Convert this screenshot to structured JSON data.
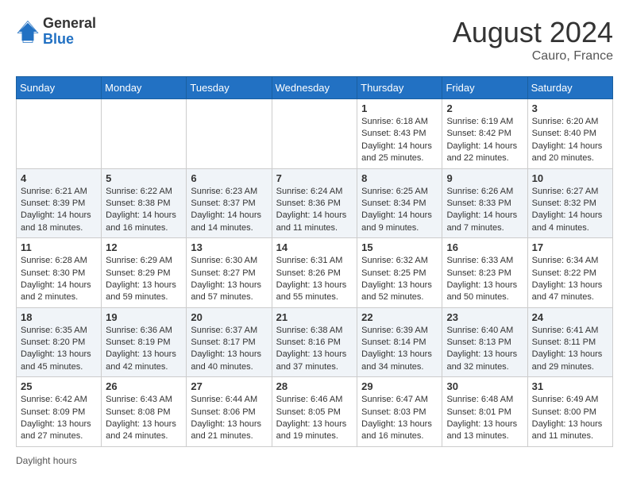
{
  "header": {
    "logo_general": "General",
    "logo_blue": "Blue",
    "month_year": "August 2024",
    "location": "Cauro, France"
  },
  "weekdays": [
    "Sunday",
    "Monday",
    "Tuesday",
    "Wednesday",
    "Thursday",
    "Friday",
    "Saturday"
  ],
  "weeks": [
    [
      {
        "day": "",
        "info": ""
      },
      {
        "day": "",
        "info": ""
      },
      {
        "day": "",
        "info": ""
      },
      {
        "day": "",
        "info": ""
      },
      {
        "day": "1",
        "info": "Sunrise: 6:18 AM\nSunset: 8:43 PM\nDaylight: 14 hours and 25 minutes."
      },
      {
        "day": "2",
        "info": "Sunrise: 6:19 AM\nSunset: 8:42 PM\nDaylight: 14 hours and 22 minutes."
      },
      {
        "day": "3",
        "info": "Sunrise: 6:20 AM\nSunset: 8:40 PM\nDaylight: 14 hours and 20 minutes."
      }
    ],
    [
      {
        "day": "4",
        "info": "Sunrise: 6:21 AM\nSunset: 8:39 PM\nDaylight: 14 hours and 18 minutes."
      },
      {
        "day": "5",
        "info": "Sunrise: 6:22 AM\nSunset: 8:38 PM\nDaylight: 14 hours and 16 minutes."
      },
      {
        "day": "6",
        "info": "Sunrise: 6:23 AM\nSunset: 8:37 PM\nDaylight: 14 hours and 14 minutes."
      },
      {
        "day": "7",
        "info": "Sunrise: 6:24 AM\nSunset: 8:36 PM\nDaylight: 14 hours and 11 minutes."
      },
      {
        "day": "8",
        "info": "Sunrise: 6:25 AM\nSunset: 8:34 PM\nDaylight: 14 hours and 9 minutes."
      },
      {
        "day": "9",
        "info": "Sunrise: 6:26 AM\nSunset: 8:33 PM\nDaylight: 14 hours and 7 minutes."
      },
      {
        "day": "10",
        "info": "Sunrise: 6:27 AM\nSunset: 8:32 PM\nDaylight: 14 hours and 4 minutes."
      }
    ],
    [
      {
        "day": "11",
        "info": "Sunrise: 6:28 AM\nSunset: 8:30 PM\nDaylight: 14 hours and 2 minutes."
      },
      {
        "day": "12",
        "info": "Sunrise: 6:29 AM\nSunset: 8:29 PM\nDaylight: 13 hours and 59 minutes."
      },
      {
        "day": "13",
        "info": "Sunrise: 6:30 AM\nSunset: 8:27 PM\nDaylight: 13 hours and 57 minutes."
      },
      {
        "day": "14",
        "info": "Sunrise: 6:31 AM\nSunset: 8:26 PM\nDaylight: 13 hours and 55 minutes."
      },
      {
        "day": "15",
        "info": "Sunrise: 6:32 AM\nSunset: 8:25 PM\nDaylight: 13 hours and 52 minutes."
      },
      {
        "day": "16",
        "info": "Sunrise: 6:33 AM\nSunset: 8:23 PM\nDaylight: 13 hours and 50 minutes."
      },
      {
        "day": "17",
        "info": "Sunrise: 6:34 AM\nSunset: 8:22 PM\nDaylight: 13 hours and 47 minutes."
      }
    ],
    [
      {
        "day": "18",
        "info": "Sunrise: 6:35 AM\nSunset: 8:20 PM\nDaylight: 13 hours and 45 minutes."
      },
      {
        "day": "19",
        "info": "Sunrise: 6:36 AM\nSunset: 8:19 PM\nDaylight: 13 hours and 42 minutes."
      },
      {
        "day": "20",
        "info": "Sunrise: 6:37 AM\nSunset: 8:17 PM\nDaylight: 13 hours and 40 minutes."
      },
      {
        "day": "21",
        "info": "Sunrise: 6:38 AM\nSunset: 8:16 PM\nDaylight: 13 hours and 37 minutes."
      },
      {
        "day": "22",
        "info": "Sunrise: 6:39 AM\nSunset: 8:14 PM\nDaylight: 13 hours and 34 minutes."
      },
      {
        "day": "23",
        "info": "Sunrise: 6:40 AM\nSunset: 8:13 PM\nDaylight: 13 hours and 32 minutes."
      },
      {
        "day": "24",
        "info": "Sunrise: 6:41 AM\nSunset: 8:11 PM\nDaylight: 13 hours and 29 minutes."
      }
    ],
    [
      {
        "day": "25",
        "info": "Sunrise: 6:42 AM\nSunset: 8:09 PM\nDaylight: 13 hours and 27 minutes."
      },
      {
        "day": "26",
        "info": "Sunrise: 6:43 AM\nSunset: 8:08 PM\nDaylight: 13 hours and 24 minutes."
      },
      {
        "day": "27",
        "info": "Sunrise: 6:44 AM\nSunset: 8:06 PM\nDaylight: 13 hours and 21 minutes."
      },
      {
        "day": "28",
        "info": "Sunrise: 6:46 AM\nSunset: 8:05 PM\nDaylight: 13 hours and 19 minutes."
      },
      {
        "day": "29",
        "info": "Sunrise: 6:47 AM\nSunset: 8:03 PM\nDaylight: 13 hours and 16 minutes."
      },
      {
        "day": "30",
        "info": "Sunrise: 6:48 AM\nSunset: 8:01 PM\nDaylight: 13 hours and 13 minutes."
      },
      {
        "day": "31",
        "info": "Sunrise: 6:49 AM\nSunset: 8:00 PM\nDaylight: 13 hours and 11 minutes."
      }
    ]
  ],
  "footer": {
    "daylight_label": "Daylight hours"
  }
}
